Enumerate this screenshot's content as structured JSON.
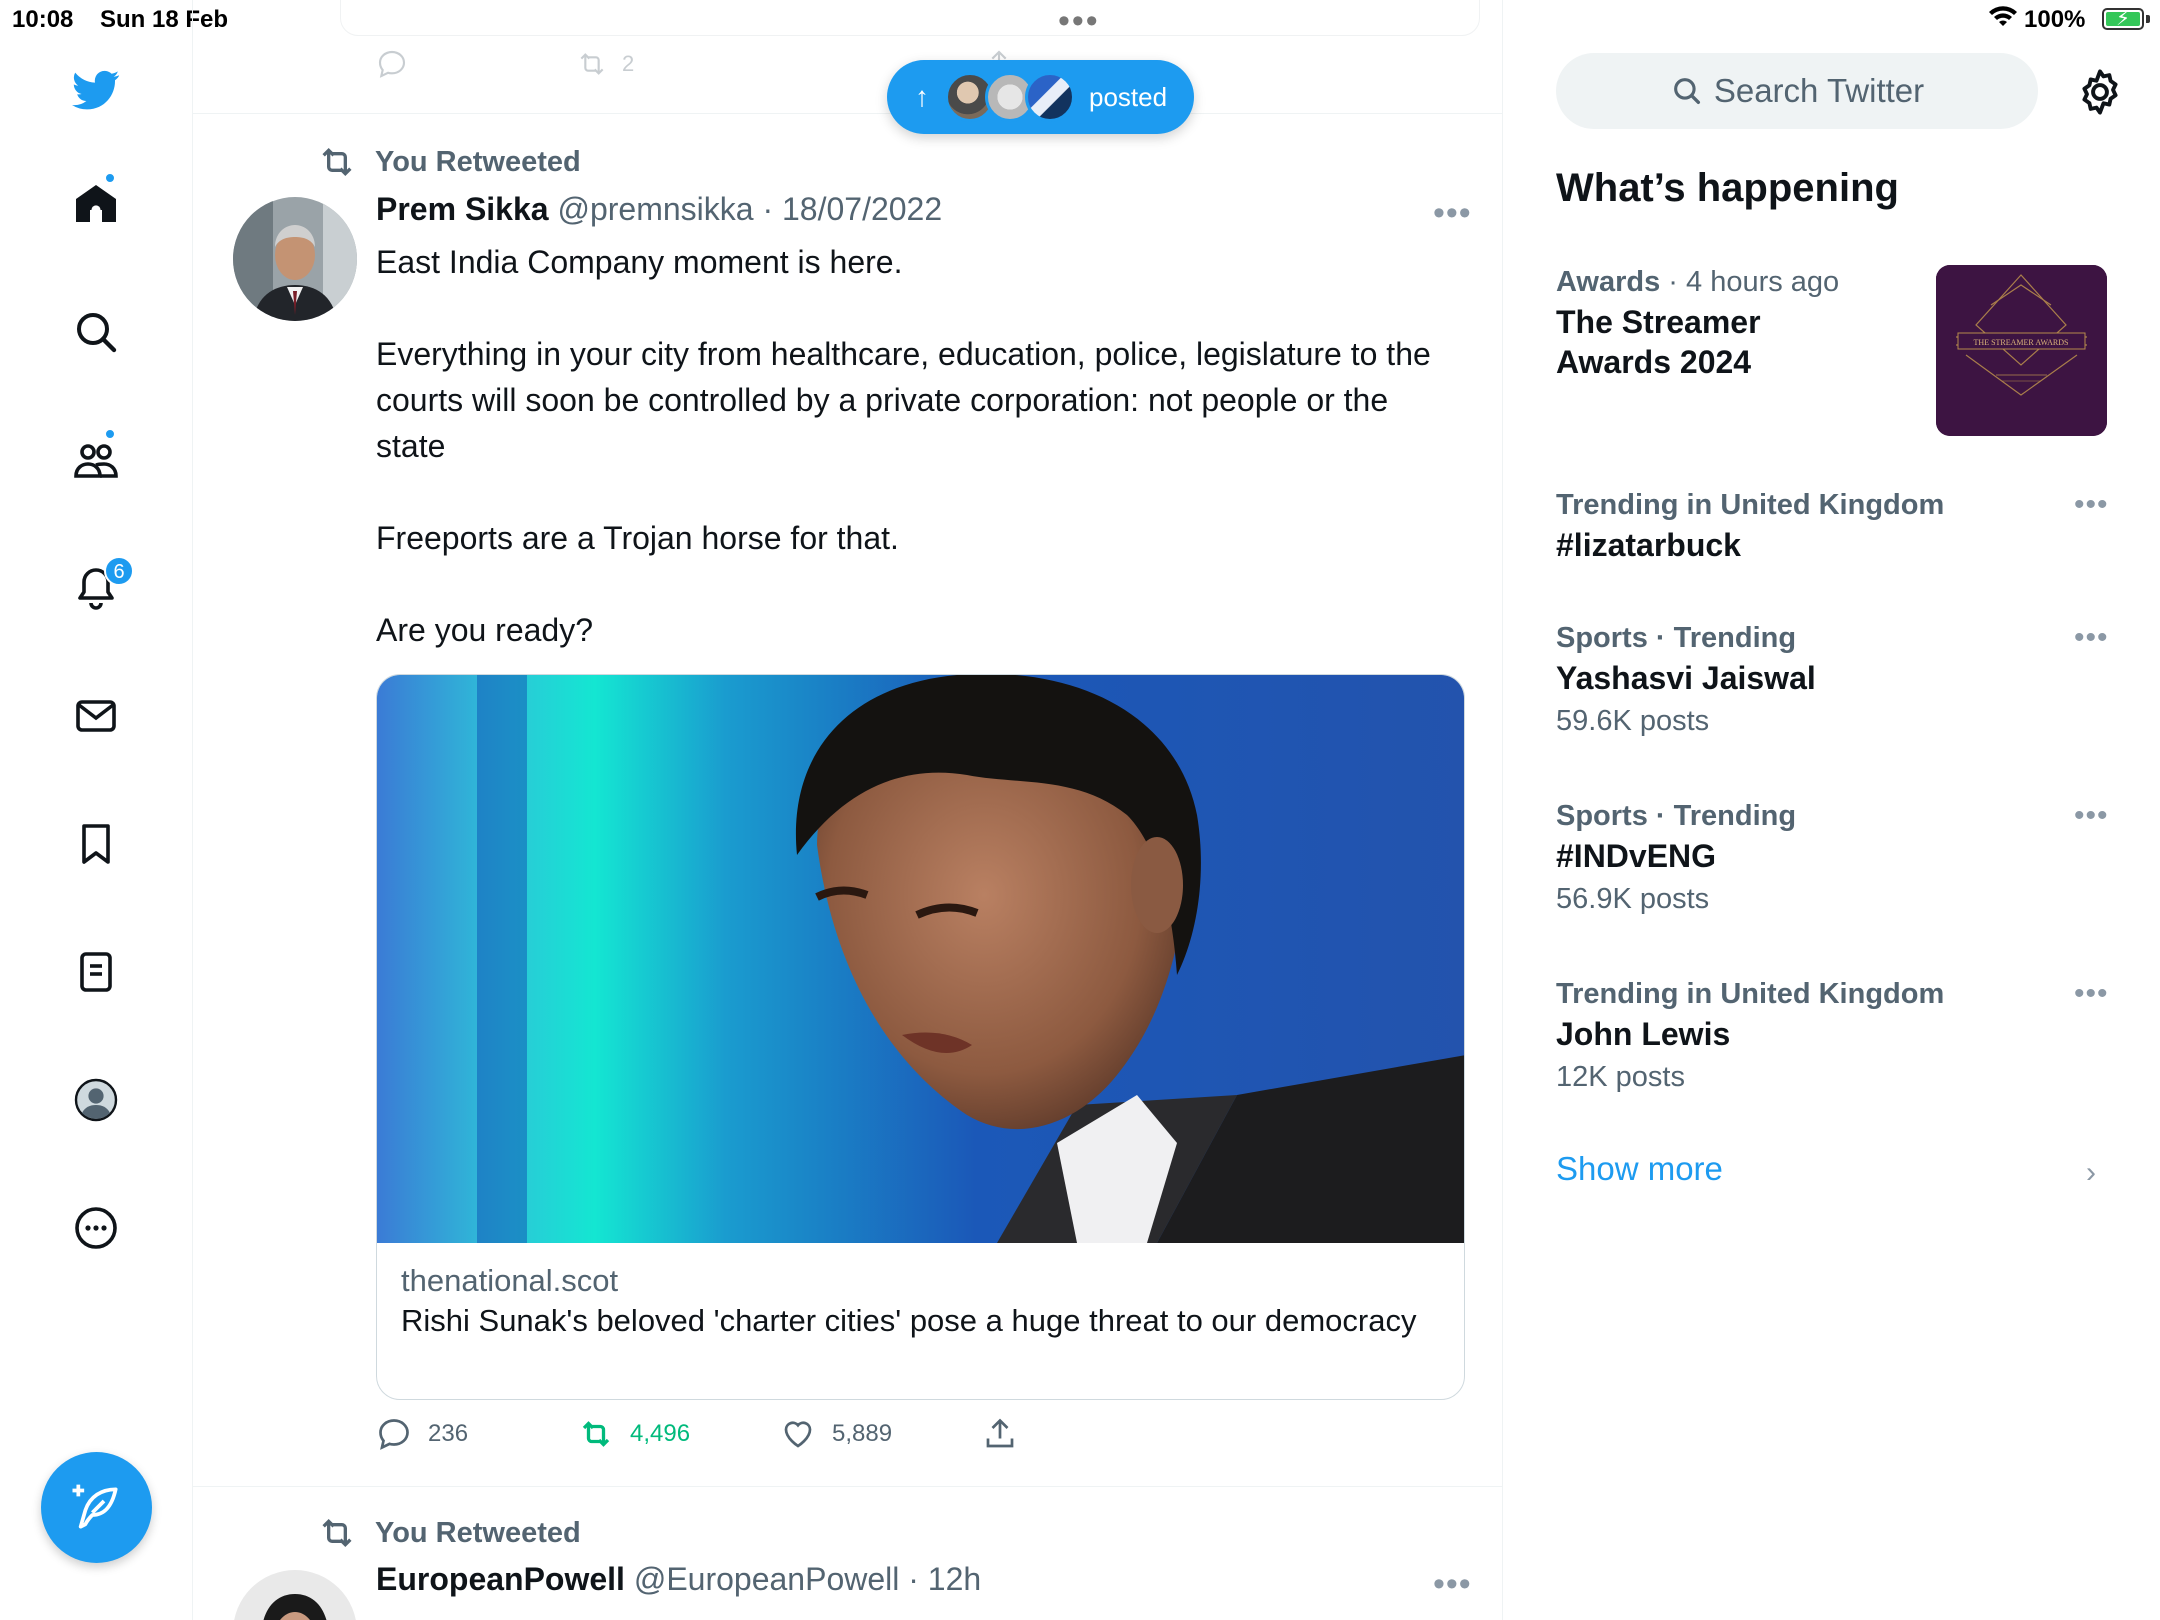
{
  "status_bar": {
    "time": "10:08",
    "date": "Sun 18 Feb",
    "battery": "100%"
  },
  "left_nav": {
    "notification_count": "6"
  },
  "prev_tweet": {
    "retweet_count": "2"
  },
  "posted_pill": {
    "label": "posted"
  },
  "tweets": [
    {
      "retweet_label": "You Retweeted",
      "name": "Prem Sikka",
      "handle": "@premnsikka",
      "date": "18/07/2022",
      "paragraphs": [
        "East India Company moment is here.",
        "Everything in your city from healthcare, education, police, legislature to the courts will soon be controlled by a private corporation: not people or the state",
        "Freeports are a Trojan horse for that.",
        "Are you ready?"
      ],
      "card": {
        "domain": "thenational.scot",
        "title": "Rishi Sunak's beloved 'charter cities' pose a huge threat to our democracy"
      },
      "stats": {
        "replies": "236",
        "retweets": "4,496",
        "likes": "5,889"
      }
    },
    {
      "retweet_label": "You Retweeted",
      "name": "EuropeanPowell",
      "handle": "@EuropeanPowell",
      "date": "12h"
    }
  ],
  "sidebar": {
    "search_placeholder": "Search Twitter",
    "section_title": "What’s happening",
    "trends": [
      {
        "category": "Awards",
        "meta_suffix": "4 hours ago",
        "title_line1": "The Streamer",
        "title_line2": "Awards 2024",
        "thumb_text": "THE STREAMER AWARDS"
      },
      {
        "category": "Trending in United Kingdom",
        "title": "#lizatarbuck"
      },
      {
        "category": "Sports · Trending",
        "title": "Yashasvi Jaiswal",
        "count": "59.6K posts"
      },
      {
        "category": "Sports · Trending",
        "title": "#INDvENG",
        "count": "56.9K posts"
      },
      {
        "category": "Trending in United Kingdom",
        "title": "John Lewis",
        "count": "12K posts"
      }
    ],
    "show_more": "Show more"
  },
  "colors": {
    "accent": "#1d9bf0",
    "retweet_green": "#00ba7c",
    "secondary_text": "#536471"
  }
}
